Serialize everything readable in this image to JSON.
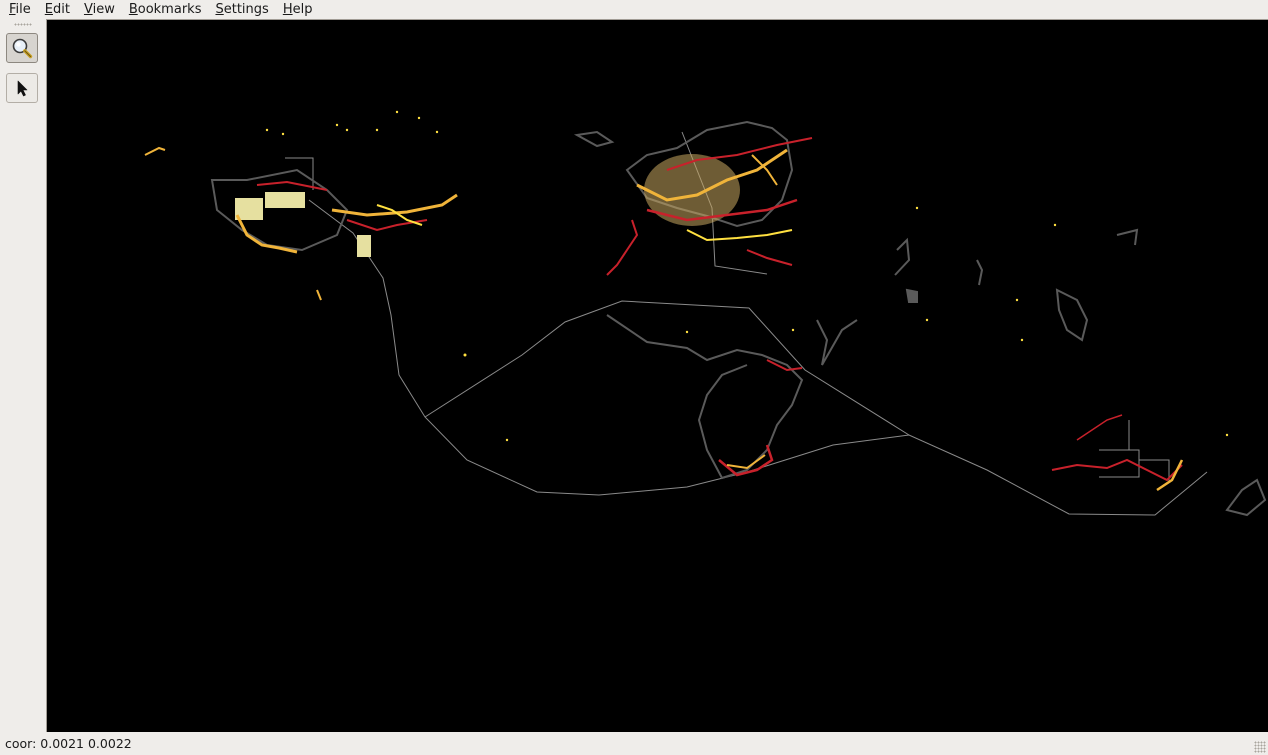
{
  "menubar": {
    "items": [
      {
        "mnemonic": "F",
        "rest": "ile"
      },
      {
        "mnemonic": "E",
        "rest": "dit"
      },
      {
        "mnemonic": "V",
        "rest": "iew"
      },
      {
        "mnemonic": "B",
        "rest": "ookmarks"
      },
      {
        "mnemonic": "S",
        "rest": "ettings"
      },
      {
        "mnemonic": "H",
        "rest": "elp"
      }
    ]
  },
  "toolbar": {
    "tools": [
      {
        "icon": "magnifier-icon",
        "active": true
      },
      {
        "icon": "pointer-arrow-icon",
        "active": false
      }
    ]
  },
  "map": {
    "background": "#000000",
    "colors": {
      "boundary": "#8a8a8a",
      "land": "#5a5a5a",
      "road_major": "#c8212b",
      "road_minor": "#f0b43a",
      "road_small": "#ffe040",
      "area_fill": "#e6e0a0"
    }
  },
  "statusbar": {
    "coordinates": "coor: 0.0021 0.0022"
  }
}
